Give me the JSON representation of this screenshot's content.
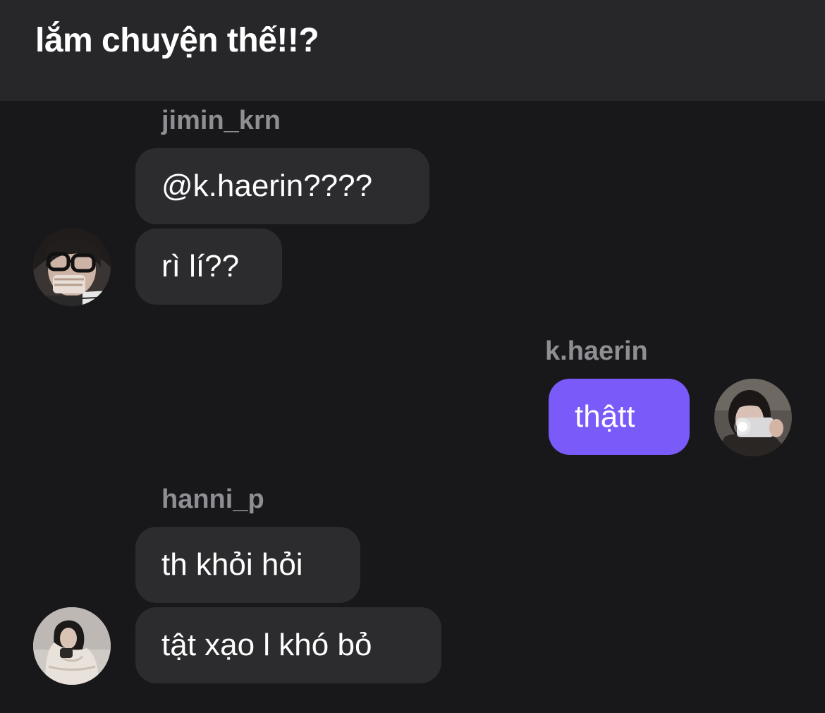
{
  "header": {
    "title": "lắm chuyện thế!!?"
  },
  "messages": {
    "group1": {
      "username": "jimin_krn",
      "bubbles": [
        "@k.haerin????",
        "rì lí??"
      ],
      "avatar_icon": "user-avatar-glasses"
    },
    "group2": {
      "username": "k.haerin",
      "bubbles": [
        "thậtt"
      ],
      "avatar_icon": "user-avatar-selfie"
    },
    "group3": {
      "username": "hanni_p",
      "bubbles": [
        "th khỏi hỏi",
        "tật xạo l khó bỏ"
      ],
      "avatar_icon": "user-avatar-jacket"
    }
  },
  "colors": {
    "background": "#18181b",
    "header": "#27272a",
    "incoming_bubble": "#2c2c2e",
    "outgoing_bubble": "#7a5af8",
    "username": "#8e8e93",
    "text": "#ffffff"
  }
}
